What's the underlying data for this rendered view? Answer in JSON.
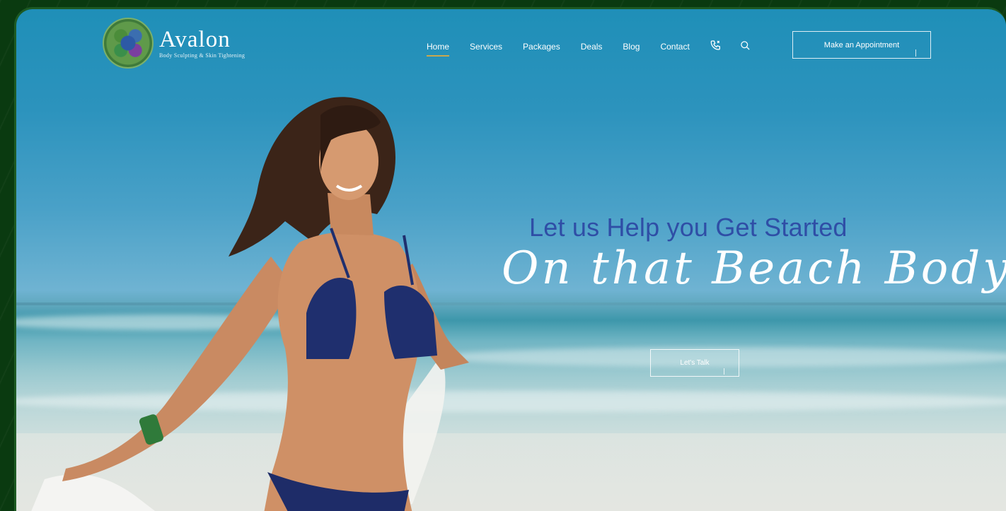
{
  "brand": {
    "name": "Avalon",
    "tagline": "Body Sculpting & Skin Tightening"
  },
  "nav": {
    "items": [
      {
        "label": "Home",
        "active": true
      },
      {
        "label": "Services",
        "active": false
      },
      {
        "label": "Packages",
        "active": false
      },
      {
        "label": "Deals",
        "active": false
      },
      {
        "label": "Blog",
        "active": false
      },
      {
        "label": "Contact",
        "active": false
      }
    ],
    "icons": [
      "phone-icon",
      "search-icon"
    ],
    "cta_label": "Make an Appointment"
  },
  "hero": {
    "headline": "Let us Help you Get Started",
    "script_line": "On that Beach Body!",
    "button_label": "Let's Talk"
  },
  "colors": {
    "frame": "#0a3a10",
    "headline": "#2f4ea6",
    "active_underline": "#c9a84f",
    "sky": "#1f8fb8"
  }
}
